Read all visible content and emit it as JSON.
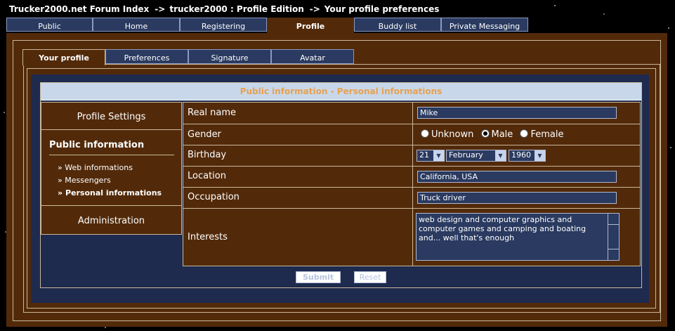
{
  "breadcrumb": {
    "part1": "Trucker2000.net Forum Index",
    "sep1": "->",
    "part2": "trucker2000 : Profile Edition",
    "sep2": "->",
    "part3": "Your profile preferences"
  },
  "main_tabs": [
    "Public",
    "Home",
    "Registering",
    "Profile",
    "Buddy list",
    "Private Messaging"
  ],
  "main_active": "Profile",
  "sub_tabs": [
    "Your profile",
    "Preferences",
    "Signature",
    "Avatar"
  ],
  "sub_active": "Your profile",
  "header": "Public information - Personal informations",
  "sidebar": {
    "profile_settings": "Profile Settings",
    "section_title": "Public information",
    "links": [
      "Web informations",
      "Messengers",
      "Personal informations"
    ],
    "link_marker": "»",
    "administration": "Administration"
  },
  "form": {
    "real_name_label": "Real name",
    "real_name_value": "Mike",
    "gender_label": "Gender",
    "gender_options": [
      "Unknown",
      "Male",
      "Female"
    ],
    "gender_selected": "Male",
    "birthday_label": "Birthday",
    "birthday_day": "21",
    "birthday_month": "February",
    "birthday_year": "1960",
    "location_label": "Location",
    "location_value": "California, USA",
    "occupation_label": "Occupation",
    "occupation_value": "Truck driver",
    "interests_label": "Interests",
    "interests_value": "web design and computer graphics and computer games and camping and boating and...  well that's enough"
  },
  "buttons": {
    "submit": "Submit",
    "reset": "Reset"
  },
  "colors": {
    "brown": "#522a0a",
    "navy": "#1e2a4e",
    "tab_blue": "#2a3a60",
    "header_bg": "#c8d8ea",
    "header_text": "#e8a050"
  }
}
